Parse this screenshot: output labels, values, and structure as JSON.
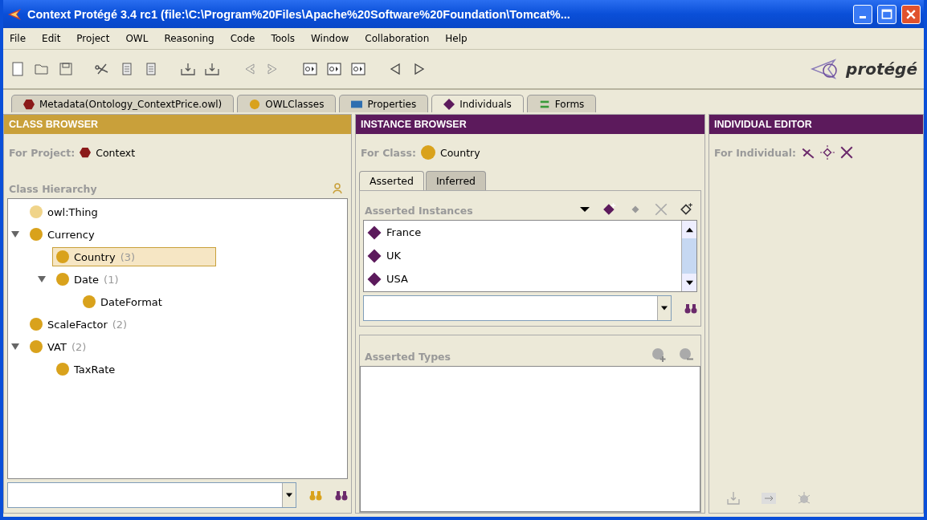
{
  "window": {
    "title": "Context  Protégé 3.4 rc1    (file:\\C:\\Program%20Files\\Apache%20Software%20Foundation\\Tomcat%..."
  },
  "menu": [
    "File",
    "Edit",
    "Project",
    "OWL",
    "Reasoning",
    "Code",
    "Tools",
    "Window",
    "Collaboration",
    "Help"
  ],
  "logo": "protégé",
  "tabs": [
    {
      "label": "Metadata(Ontology_ContextPrice.owl)",
      "kind": "metadata",
      "selected": false
    },
    {
      "label": "OWLClasses",
      "kind": "classes",
      "selected": false
    },
    {
      "label": "Properties",
      "kind": "properties",
      "selected": false
    },
    {
      "label": "Individuals",
      "kind": "individuals",
      "selected": true
    },
    {
      "label": "Forms",
      "kind": "forms",
      "selected": false
    }
  ],
  "class_browser": {
    "header": "CLASS BROWSER",
    "project_label": "For Project:",
    "project": "Context",
    "hierarchy_title": "Class Hierarchy",
    "tree": [
      {
        "label": "owl:Thing",
        "kind": "thing",
        "selected": false
      },
      {
        "label": "Currency",
        "kind": "class",
        "selected": false,
        "expanded": true,
        "children": [
          {
            "label": "Country",
            "count": "(3)",
            "kind": "class",
            "selected": true
          },
          {
            "label": "Date",
            "count": "(1)",
            "kind": "class",
            "selected": false,
            "expanded": true,
            "children": [
              {
                "label": "DateFormat",
                "kind": "class",
                "selected": false
              }
            ]
          }
        ]
      },
      {
        "label": "ScaleFactor",
        "count": "(2)",
        "kind": "class",
        "selected": false
      },
      {
        "label": "VAT",
        "count": "(2)",
        "kind": "class",
        "selected": false,
        "expanded": true,
        "children": [
          {
            "label": "TaxRate",
            "kind": "class",
            "selected": false
          }
        ]
      }
    ]
  },
  "instance_browser": {
    "header": "INSTANCE BROWSER",
    "class_label": "For Class:",
    "class": "Country",
    "tabs": [
      {
        "label": "Asserted",
        "selected": true
      },
      {
        "label": "Inferred",
        "selected": false
      }
    ],
    "instances_title": "Asserted Instances",
    "instances": [
      "France",
      "UK",
      "USA"
    ],
    "types_title": "Asserted Types"
  },
  "individual_editor": {
    "header": "INDIVIDUAL EDITOR",
    "individual_label": "For Individual:"
  }
}
